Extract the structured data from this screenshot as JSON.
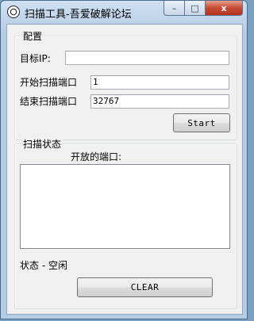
{
  "window": {
    "title": "扫描工具-吾爱破解论坛",
    "minimize_glyph": "–",
    "maximize_glyph": "□",
    "close_glyph": "x"
  },
  "config": {
    "legend": "配置",
    "target_ip_label": "目标IP:",
    "target_ip_value": "",
    "start_port_label": "开始扫描端口",
    "start_port_value": "1",
    "end_port_label": "结束扫描端口",
    "end_port_value": "32767",
    "start_button": "Start"
  },
  "status": {
    "legend": "扫描状态",
    "open_ports_label": "开放的端口:",
    "open_ports": [],
    "status_text": "状态 - 空闲",
    "clear_button": "CLEAR"
  }
}
